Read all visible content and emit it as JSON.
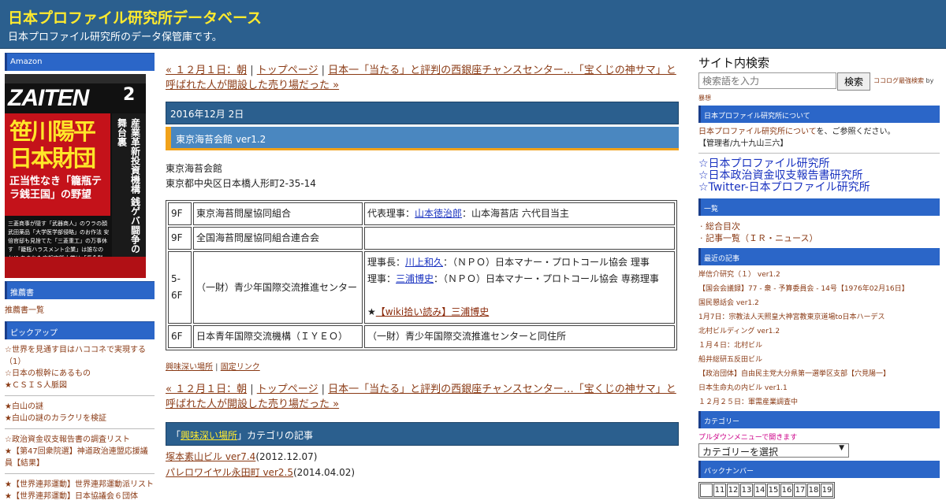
{
  "header": {
    "title": "日本プロファイル研究所データベース",
    "description": "日本プロファイル研究所のデータ保管庫です。"
  },
  "left": {
    "amazon_head": "Amazon",
    "zaiten": {
      "logo": "ZAITEN",
      "issue": "2",
      "headline1": "笹川陽平",
      "headline2": "日本財団",
      "sub": "正当性なき「籠瓶テラ銭王国」の野望",
      "side": "産業革新投資機構 銭ゲバ闘争の舞台裏",
      "bottom": "三菱商事が隠す「武器商人」のウラの顔 武田薬品「大学医学部侵略」のお作法 安倍官邸も見捨てた「三菱重工」の万事休す 「籠瓶ハラスメント企業」は誰なのか!? あきれた広報実態大賞は「長永製菓」に決定!"
    },
    "suisen_head": "推薦書",
    "suisen_items": [
      "推薦書一覧"
    ],
    "pickup_head": "ピックアップ",
    "pickup_groups": [
      [
        "☆世界を見通す目はハココネで実現する（1）",
        "☆日本の根幹にあるもの",
        "★ＣＳＩＳ人脈図"
      ],
      [
        "★白山の謎",
        "★白山の謎のカラクリを検証"
      ],
      [
        "☆政治資金収支報告書の調査リスト",
        "★【第47回衆院選】神道政治連盟応援議員【結果】"
      ],
      [
        "★【世界連邦運動】世界連邦運動派リスト",
        "★【世界連邦運動】日本協議会６団体"
      ]
    ]
  },
  "main": {
    "nav": {
      "prev": "« １２月１日：朝",
      "sep1": " | ",
      "top": "トップページ",
      "sep2": " | ",
      "next": "日本一「当たる」と評判の西銀座チャンスセンター…「宝くじの神サマ」と呼ばれた人が開設した売り場だった »"
    },
    "date": "2016年12月 2日",
    "entry_title": "東京海苔会館 ver1.2",
    "body_line1": "東京海苔会館",
    "body_line2": "東京都中央区日本橋人形町2-35-14",
    "rows": [
      {
        "floor": "9F",
        "org": "東京海苔問屋協同組合",
        "detail_prefix": "代表理事：",
        "detail_link": "山本徳治郎",
        "detail_suffix": "：山本海苔店 六代目当主"
      },
      {
        "floor": "9F",
        "org": "全国海苔問屋協同組合連合会"
      },
      {
        "floor": "5-6F",
        "org": "（一財）青少年国際交流推進センター",
        "l1_prefix": "理事長：",
        "l1_link": "川上和久",
        "l1_suffix": "：（ＮＰＯ）日本マナー・プロトコール協会 理事",
        "l2_prefix": "理事：",
        "l2_link": "三浦博史",
        "l2_suffix": "：（ＮＰＯ）日本マナー・プロトコール協会 専務理事",
        "star": "★",
        "wiki": "【wiki拾い読み】三浦博史"
      },
      {
        "floor": "6F",
        "org": "日本青年国際交流機構（ＩＹＥＯ）",
        "detail": "（一財）青少年国際交流推進センターと同住所"
      }
    ],
    "postmeta": {
      "cat": "興味深い場所",
      "sep": " | ",
      "perma": "固定リンク"
    },
    "cat_bar": {
      "open": "「",
      "cat": "興味深い場所",
      "rest": "」カテゴリの記事"
    },
    "cat_items": [
      {
        "link": "塚本素山ビル ver7.4",
        "date": "(2012.12.07)"
      },
      {
        "link": "パレロワイヤル永田町 ver2.5",
        "date": "(2014.04.02)"
      }
    ]
  },
  "right": {
    "search_title": "サイト内検索",
    "search_placeholder": "検索語を入力",
    "search_button": "検索",
    "kokoro_link": "ココログ最強検索",
    "kokoro_by": " by",
    "bousou": "暴想",
    "about_head": "日本プロファイル研究所について",
    "about_link": "日本プロファイル研究所について",
    "about_text": "を、ご参照ください。",
    "admin": "【管理者/九十九山三六】",
    "big_links": [
      "☆日本プロファイル研究所",
      "☆日本政治資金収支報告書研究所",
      "☆Twitter-日本プロファイル研究所"
    ],
    "ichiran_head": "一覧",
    "ichiran_items": [
      "· 総合目次",
      "· 記事一覧（ＩＲ・ニュース）"
    ],
    "recent_head": "最近の記事",
    "recent_items": [
      "岸信介研究（１） ver1.2",
      "【国会会議録】77 - 衆 - 予算委員会 - 14号【1976年02月16日】",
      "国民懇話会 ver1.2",
      "1月7日：宗教法人天照皇大神宮教東京道場to日本ハーデス",
      "北村ビルディング ver1.2",
      "１月４日：北村ビル",
      "船井総研五反田ビル",
      "【政治団体】自由民主党大分県第一選挙区支部【穴見陽一】",
      "日本生命丸の内ビル ver1.1",
      "１２月２５日：軍需産業調査中"
    ],
    "category_head": "カテゴリー",
    "category_note": "プルダウンメニューで開きます",
    "category_select": "カテゴリーを選択",
    "backnumber_head": "バックナンバー",
    "calendar": [
      "",
      "11",
      "12",
      "13",
      "14",
      "15",
      "16",
      "17",
      "18",
      "19"
    ]
  }
}
